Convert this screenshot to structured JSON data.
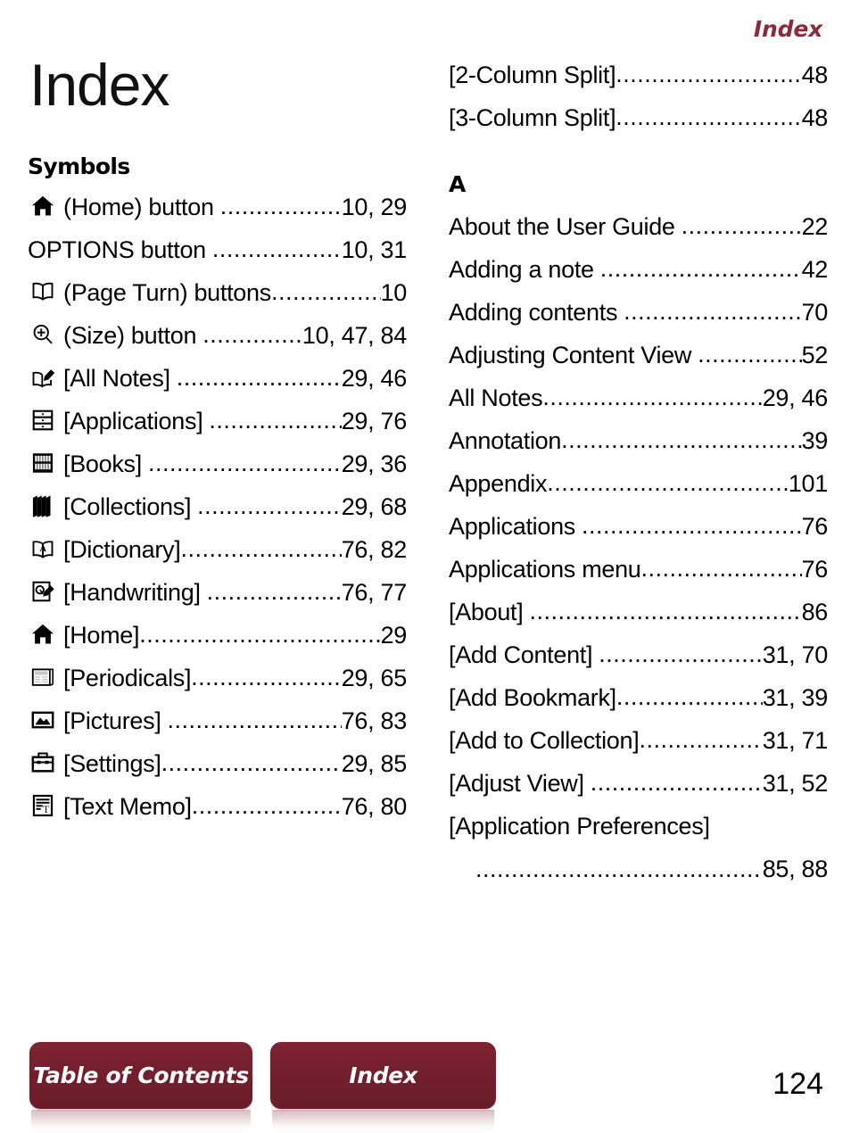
{
  "header": {
    "running_title": "Index"
  },
  "left_column": {
    "title": "Index",
    "section_heading": "Symbols",
    "entries": [
      {
        "icon": "home-icon",
        "label": "(Home) button",
        "pages": "10, 29",
        "gap": true
      },
      {
        "icon": null,
        "label": "OPTIONS button",
        "pages": "10, 31",
        "gap": true
      },
      {
        "icon": "page-turn-icon",
        "label": "(Page Turn) buttons",
        "pages": "10",
        "gap": false
      },
      {
        "icon": "size-icon",
        "label": "(Size) button",
        "pages": "10, 47, 84",
        "gap": true
      },
      {
        "icon": "all-notes-icon",
        "label": "[All Notes]",
        "pages": "29, 46",
        "gap": true
      },
      {
        "icon": "applications-icon",
        "label": "[Applications]",
        "pages": "29, 76",
        "gap": true
      },
      {
        "icon": "books-icon",
        "label": "[Books]",
        "pages": "29, 36",
        "gap": true
      },
      {
        "icon": "collections-icon",
        "label": "[Collections]",
        "pages": "29, 68",
        "gap": true
      },
      {
        "icon": "dictionary-icon",
        "label": "[Dictionary]",
        "pages": "76, 82",
        "gap": false
      },
      {
        "icon": "handwriting-icon",
        "label": "[Handwriting]",
        "pages": "76, 77",
        "gap": true
      },
      {
        "icon": "home-icon",
        "label": "[Home]",
        "pages": "29",
        "gap": false
      },
      {
        "icon": "periodicals-icon",
        "label": "[Periodicals]",
        "pages": "29, 65",
        "gap": false
      },
      {
        "icon": "pictures-icon",
        "label": "[Pictures]",
        "pages": "76, 83",
        "gap": true
      },
      {
        "icon": "settings-icon",
        "label": "[Settings]",
        "pages": "29, 85",
        "gap": false
      },
      {
        "icon": "text-memo-icon",
        "label": "[Text Memo]",
        "pages": "76, 80",
        "gap": false
      }
    ]
  },
  "right_column": {
    "top_entries": [
      {
        "label": "[2-Column Split]",
        "pages": "48",
        "gap": false
      },
      {
        "label": "[3-Column Split]",
        "pages": "48",
        "gap": false
      }
    ],
    "section_heading": "A",
    "entries": [
      {
        "label": "About the User Guide",
        "pages": "22",
        "gap": true
      },
      {
        "label": "Adding a note",
        "pages": "42",
        "gap": true
      },
      {
        "label": "Adding contents",
        "pages": "70",
        "gap": true
      },
      {
        "label": "Adjusting Content View",
        "pages": "52",
        "gap": true
      },
      {
        "label": "All Notes",
        "pages": "29, 46",
        "gap": false
      },
      {
        "label": "Annotation",
        "pages": "39",
        "gap": false
      },
      {
        "label": "Appendix",
        "pages": " 101",
        "gap": false
      },
      {
        "label": "Applications",
        "pages": "76",
        "gap": true
      },
      {
        "label": "Applications menu",
        "pages": "76",
        "gap": false
      },
      {
        "label": "[About]",
        "pages": "86",
        "gap": true
      },
      {
        "label": "[Add Content]",
        "pages": "31, 70",
        "gap": true
      },
      {
        "label": "[Add Bookmark]",
        "pages": "31, 39",
        "gap": false
      },
      {
        "label": "[Add to Collection]",
        "pages": "31, 71",
        "gap": false
      },
      {
        "label": "[Adjust View]",
        "pages": "31, 52",
        "gap": true
      }
    ],
    "wrapped_entry": {
      "label": "[Application Preferences]",
      "pages": "85, 88"
    }
  },
  "footer": {
    "buttons": [
      {
        "name": "table-of-contents",
        "label": "Table of Contents"
      },
      {
        "name": "index",
        "label": "Index"
      }
    ],
    "page_number": "124"
  },
  "colors": {
    "accent_red": "#8B2A38",
    "button_red": "#702030",
    "text": "#000000"
  },
  "leader_dots": "................................................................................"
}
